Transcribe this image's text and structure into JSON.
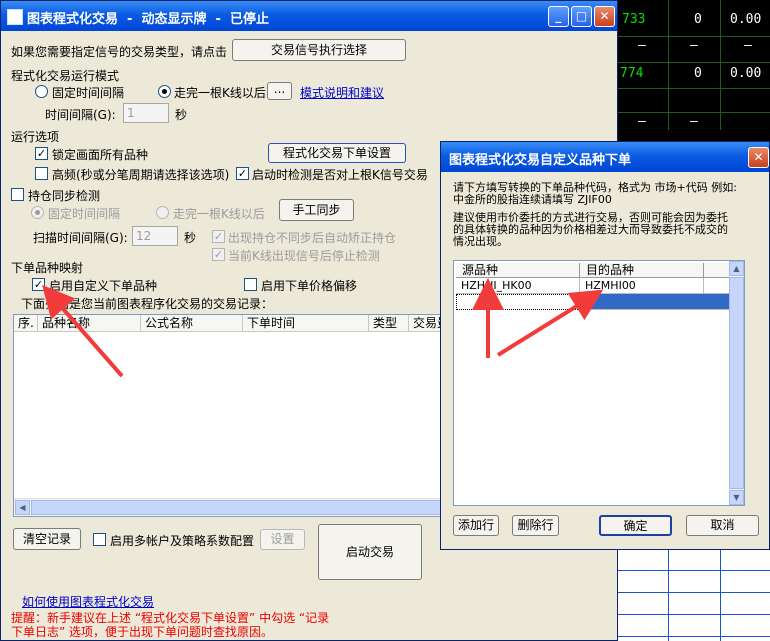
{
  "background": {
    "values": [
      "733",
      "0",
      "0.00",
      "—",
      "—",
      "—",
      "774",
      "0",
      "0.00",
      "—",
      "—"
    ]
  },
  "main": {
    "title": "图表程式化交易  -  动态显示牌  -  已停止",
    "signal_prompt": "如果您需要指定信号的交易类型，请点击",
    "signal_button": "交易信号执行选择",
    "mode_heading": "程式化交易运行模式",
    "mode_fixed": "固定时间间隔",
    "mode_bar": "走完一根K线以后",
    "dots_button": "...",
    "mode_link": "模式说明和建议",
    "interval_label": "时间间隔(G):",
    "interval_value": "1",
    "interval_unit": "秒",
    "run_heading": "运行选项",
    "lock_label": "锁定画面所有品种",
    "order_settings_button": "程式化交易下单设置",
    "hf_label": "高频(秒或分笔周期请选择该选项)",
    "startup_check_label": "启动时检测是否对上根K信号交易",
    "sync_label": "持仓同步检测",
    "sync_fixed": "固定时间间隔",
    "sync_bar": "走完一根K线以后",
    "manual_sync_button": "手工同步",
    "scan_label": "扫描时间间隔(G):",
    "scan_value": "12",
    "scan_unit": "秒",
    "auto_fix_label": "出现持仓不同步后自动矫正持仓",
    "stop_detect_label": "当前K线出现信号后停止检测",
    "mapping_heading": "下单品种映射",
    "custom_symbol_label": "启用自定义下单品种",
    "price_offset_label": "启用下单价格偏移",
    "records_label": "下面列出是您当前图表程序化交易的交易记录：",
    "columns": [
      "序.",
      "品种名称",
      "公式名称",
      "下单时间",
      "类型",
      "交易量"
    ],
    "clear_button": "清空记录",
    "multi_account_label": "启用多帐户及策略系数配置",
    "config_button": "设置",
    "start_button": "启动交易",
    "howto_link": "如何使用图表程式化交易",
    "warning_line1": "提醒：新手建议在上述 “程式化交易下单设置” 中勾选 “记录",
    "warning_line2": "下单日志” 选项，便于出现下单问题时查找原因。"
  },
  "dialog": {
    "title": "图表程式化交易自定义品种下单",
    "desc_line1": "请下方填写转换的下单品种代码，格式为 市场+代码 例如:",
    "desc_line2": "中金所的股指连续请填写 ZJIF00",
    "desc_line3": "建议使用市价委托的方式进行交易，否则可能会因为委托",
    "desc_line4": "的具体转换的品种因为价格相差过大而导致委托不成交的",
    "desc_line5": "情况出现。",
    "col_source": "源品种",
    "col_target": "目的品种",
    "rows": [
      {
        "source": "HZHHI_HK00",
        "target": "HZMHI00"
      }
    ],
    "add_button": "添加行",
    "delete_button": "删除行",
    "ok_button": "确定",
    "cancel_button": "取消"
  }
}
